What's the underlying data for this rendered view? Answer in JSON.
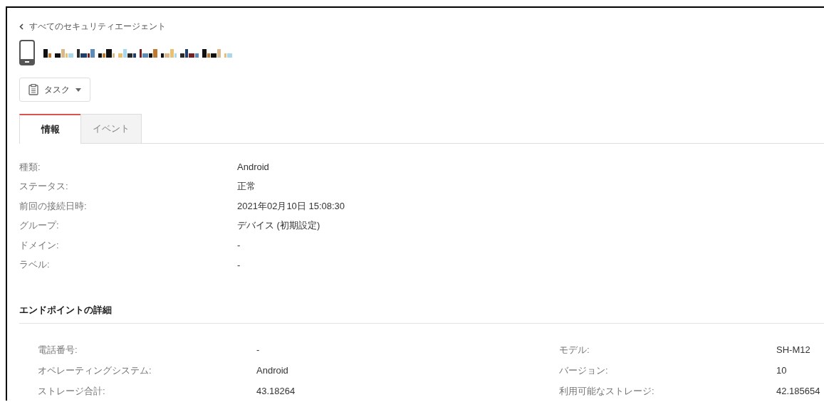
{
  "back_link": {
    "label": "すべてのセキュリティエージェント"
  },
  "task_button": {
    "label": "タスク"
  },
  "tabs": [
    {
      "label": "情報",
      "selected": true
    },
    {
      "label": "イベント",
      "selected": false
    }
  ],
  "info": [
    {
      "label": "種類:",
      "value": "Android"
    },
    {
      "label": "ステータス:",
      "value": "正常"
    },
    {
      "label": "前回の接続日時:",
      "value": "2021年02月10日 15:08:30"
    },
    {
      "label": "グループ:",
      "value": "デバイス (初期設定)"
    },
    {
      "label": "ドメイン:",
      "value": "-"
    },
    {
      "label": "ラベル:",
      "value": "-"
    }
  ],
  "endpoint_details": {
    "title": "エンドポイントの詳細",
    "rows": [
      {
        "label": "電話番号:",
        "value": "-"
      },
      {
        "label": "モデル:",
        "value": "SH-M12"
      },
      {
        "label": "オペレーティングシステム:",
        "value": "Android"
      },
      {
        "label": "バージョン:",
        "value": "10"
      },
      {
        "label": "ストレージ合計:",
        "value": "43.18264"
      },
      {
        "label": "利用可能なストレージ:",
        "value": "42.185654"
      }
    ]
  }
}
